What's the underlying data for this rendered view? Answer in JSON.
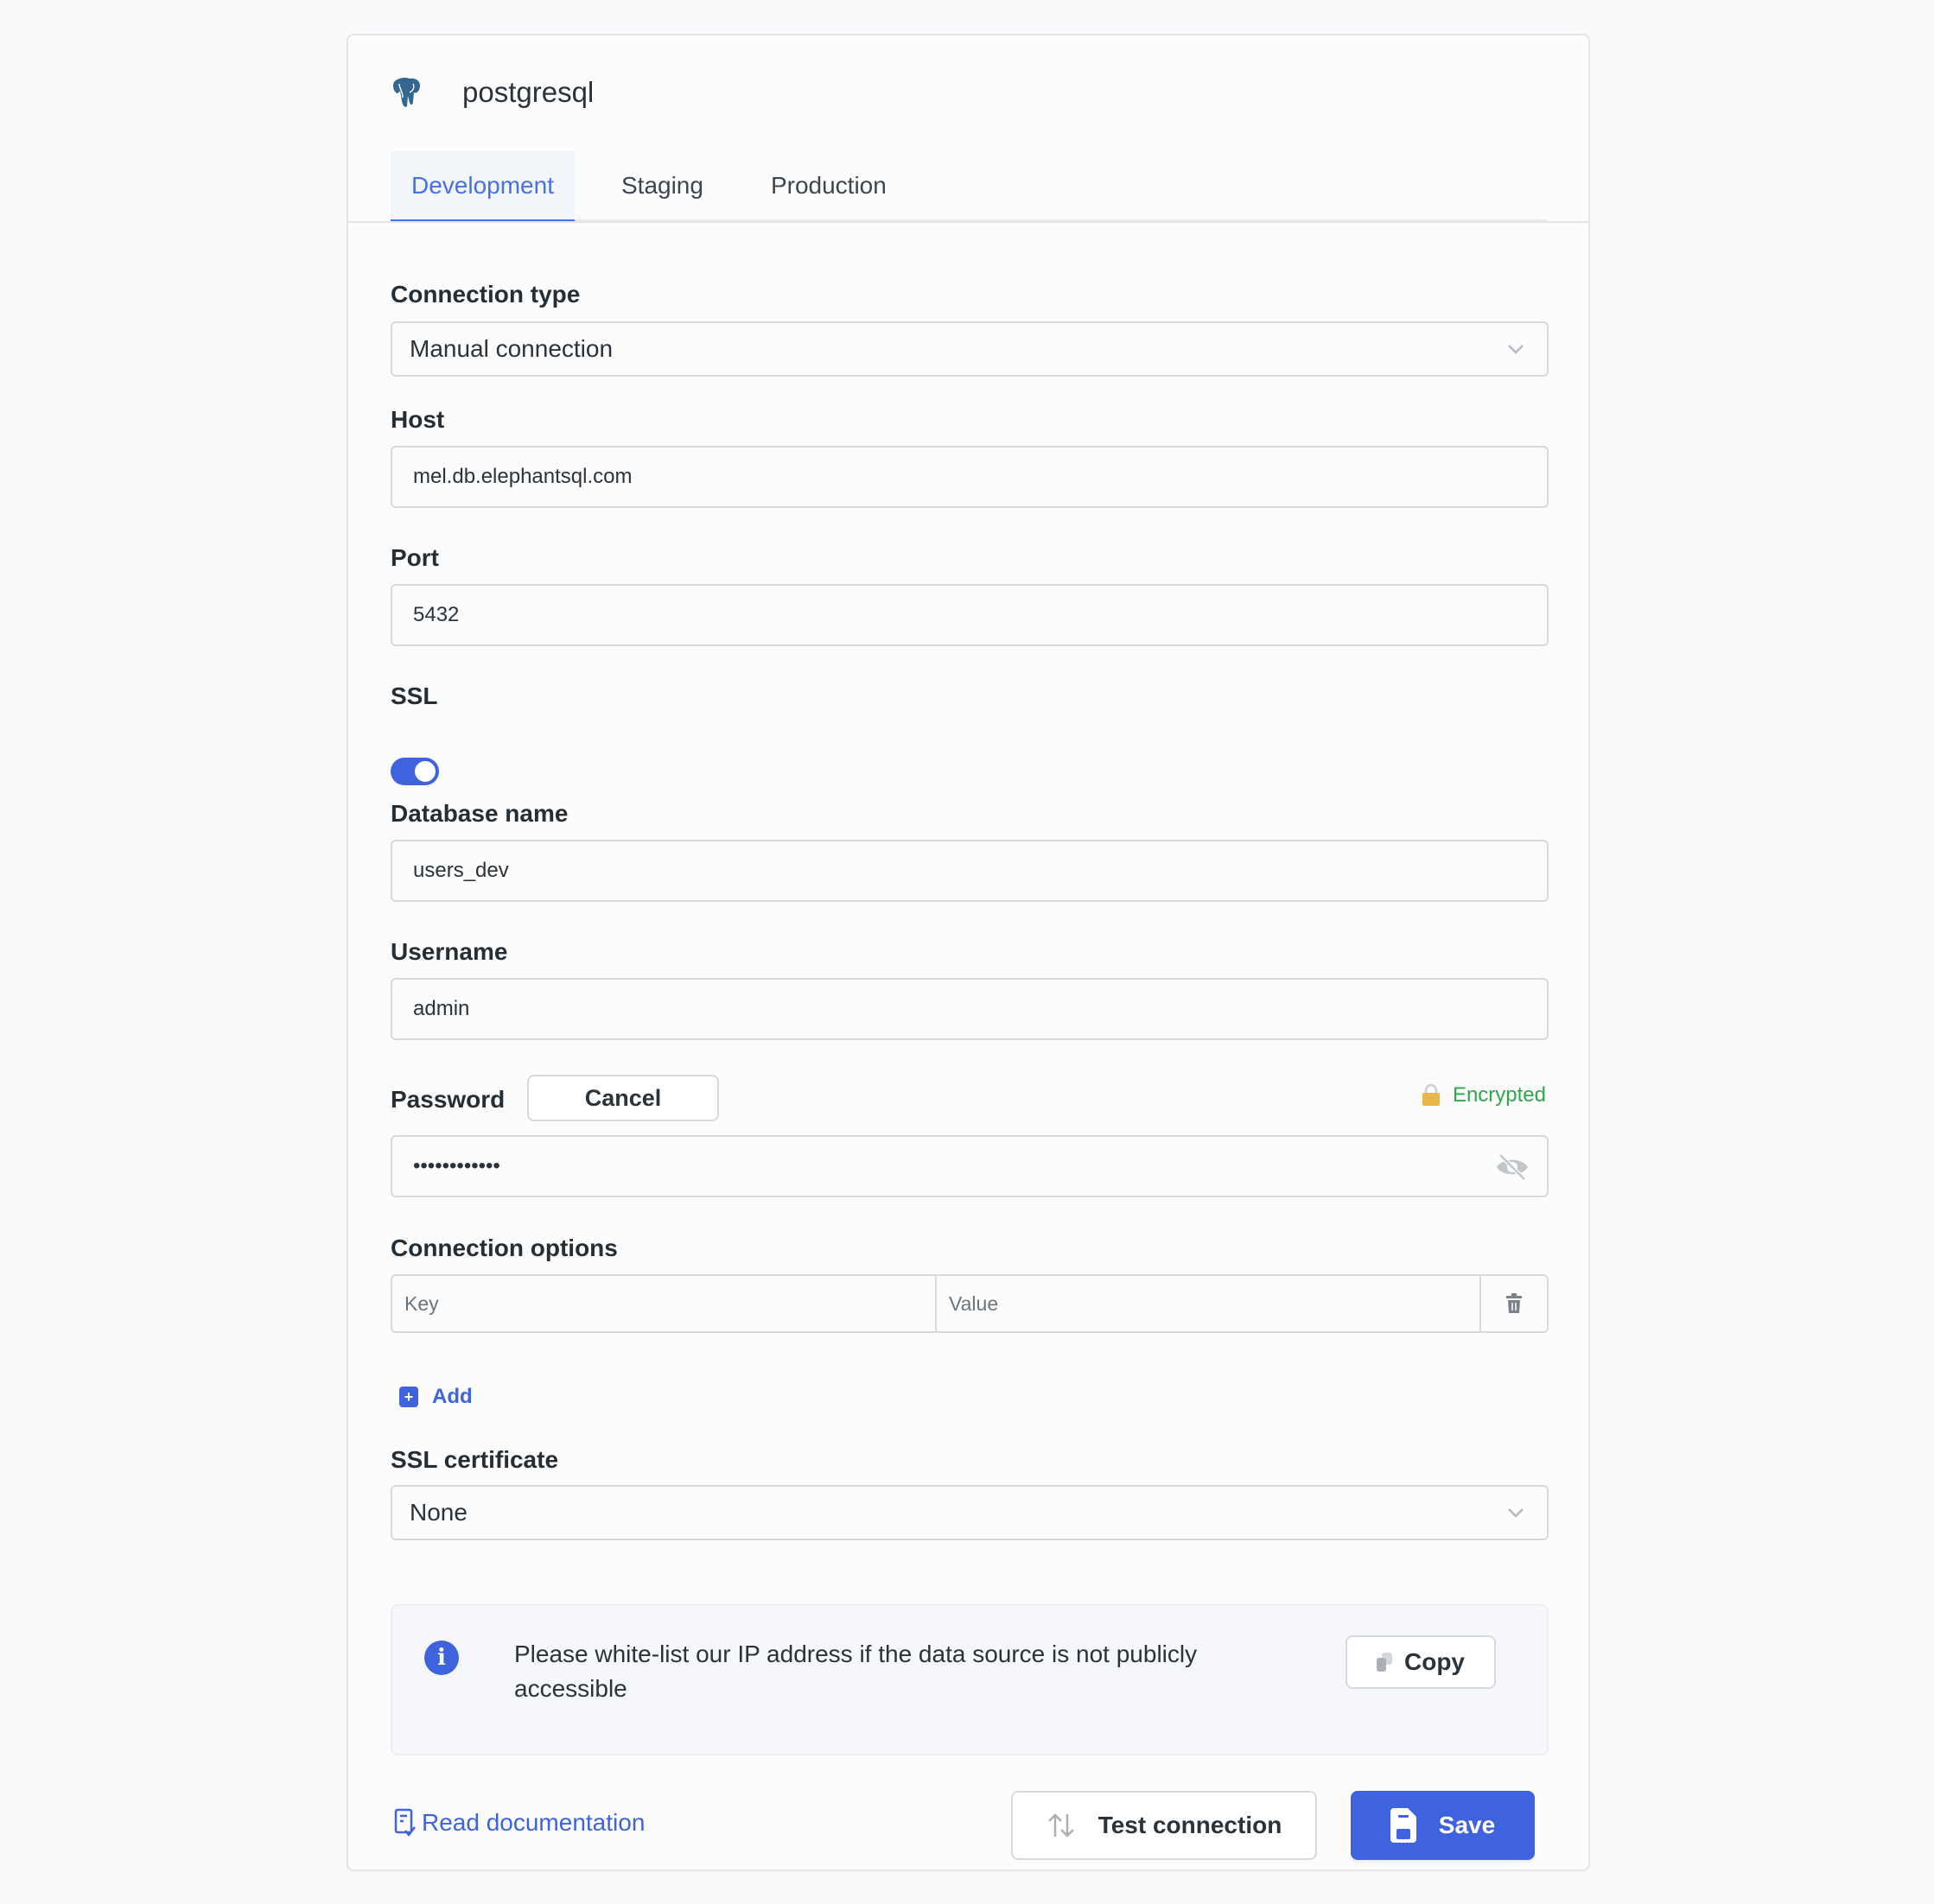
{
  "header": {
    "title": "postgresql",
    "logo_icon": "postgresql-elephant-icon"
  },
  "tabs": [
    {
      "label": "Development",
      "active": true
    },
    {
      "label": "Staging",
      "active": false
    },
    {
      "label": "Production",
      "active": false
    }
  ],
  "form": {
    "connection_type": {
      "label": "Connection type",
      "value": "Manual connection"
    },
    "host": {
      "label": "Host",
      "value": "mel.db.elephantsql.com"
    },
    "port": {
      "label": "Port",
      "value": "5432"
    },
    "ssl": {
      "label": "SSL",
      "enabled": true
    },
    "database_name": {
      "label": "Database name",
      "value": "users_dev"
    },
    "username": {
      "label": "Username",
      "value": "admin"
    },
    "password": {
      "label": "Password",
      "cancel_label": "Cancel",
      "status": "Encrypted",
      "value": "••••••••••••",
      "status_color": "#2da84a"
    },
    "connection_options": {
      "label": "Connection options",
      "key_placeholder": "Key",
      "value_placeholder": "Value",
      "add_label": "Add"
    },
    "ssl_certificate": {
      "label": "SSL certificate",
      "value": "None"
    }
  },
  "info": {
    "text": "Please white-list our IP address if the data source is not publicly accessible",
    "copy_label": "Copy"
  },
  "footer": {
    "doc_link": "Read documentation",
    "test_label": "Test connection",
    "save_label": "Save"
  },
  "colors": {
    "accent": "#3e63dd",
    "tab_active": "#4770e6",
    "lock": "#e8b84a"
  }
}
